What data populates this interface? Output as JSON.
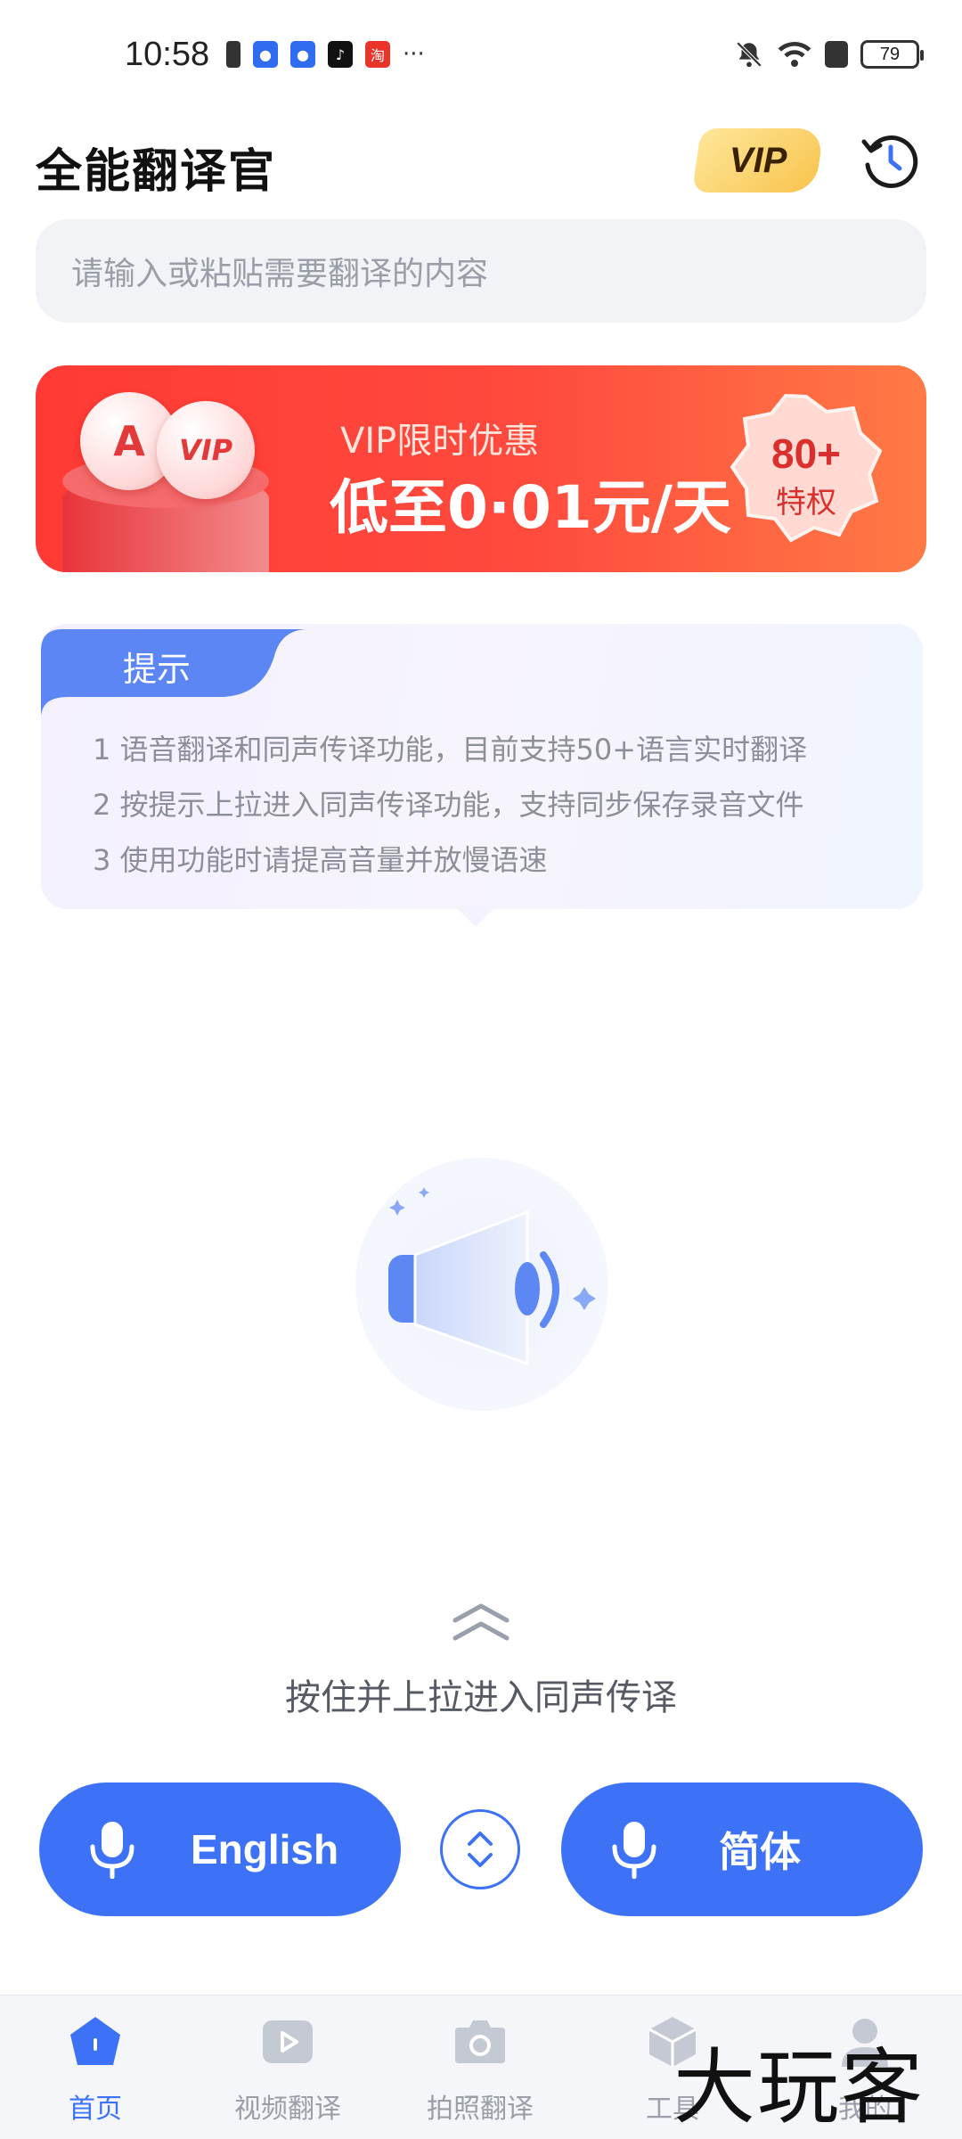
{
  "status_bar": {
    "time": "10:58",
    "battery": "79",
    "more": "···"
  },
  "header": {
    "title": "全能翻译官",
    "vip_label": "VIP",
    "history_icon": "history-clock-icon"
  },
  "search": {
    "placeholder": "请输入或粘贴需要翻译的内容"
  },
  "banner": {
    "subtitle": "VIP限时优惠",
    "headline": "低至0·01元/天",
    "badge_value": "80+",
    "badge_label": "特权",
    "coin_left": "A",
    "coin_right": "VIP"
  },
  "tips": {
    "title": "提示",
    "lines": [
      "1 语音翻译和同声传译功能，目前支持50+语言实时翻译",
      "2 按提示上拉进入同声传译功能，支持同步保存录音文件",
      "3 使用功能时请提高音量并放慢语速"
    ]
  },
  "pull_hint": "按住并上拉进入同声传译",
  "languages": {
    "source": "English",
    "target": "简体"
  },
  "nav": {
    "items": [
      {
        "label": "首页",
        "icon": "home-icon",
        "active": true
      },
      {
        "label": "视频翻译",
        "icon": "video-icon",
        "active": false
      },
      {
        "label": "拍照翻译",
        "icon": "camera-icon",
        "active": false
      },
      {
        "label": "工具",
        "icon": "toolbox-icon",
        "active": false
      },
      {
        "label": "我的",
        "icon": "profile-icon",
        "active": false
      }
    ]
  },
  "watermark": "大玩客",
  "colors": {
    "accent": "#3d72f7",
    "banner_red": "#ff3a35",
    "vip_gold": "#f8c44d"
  }
}
